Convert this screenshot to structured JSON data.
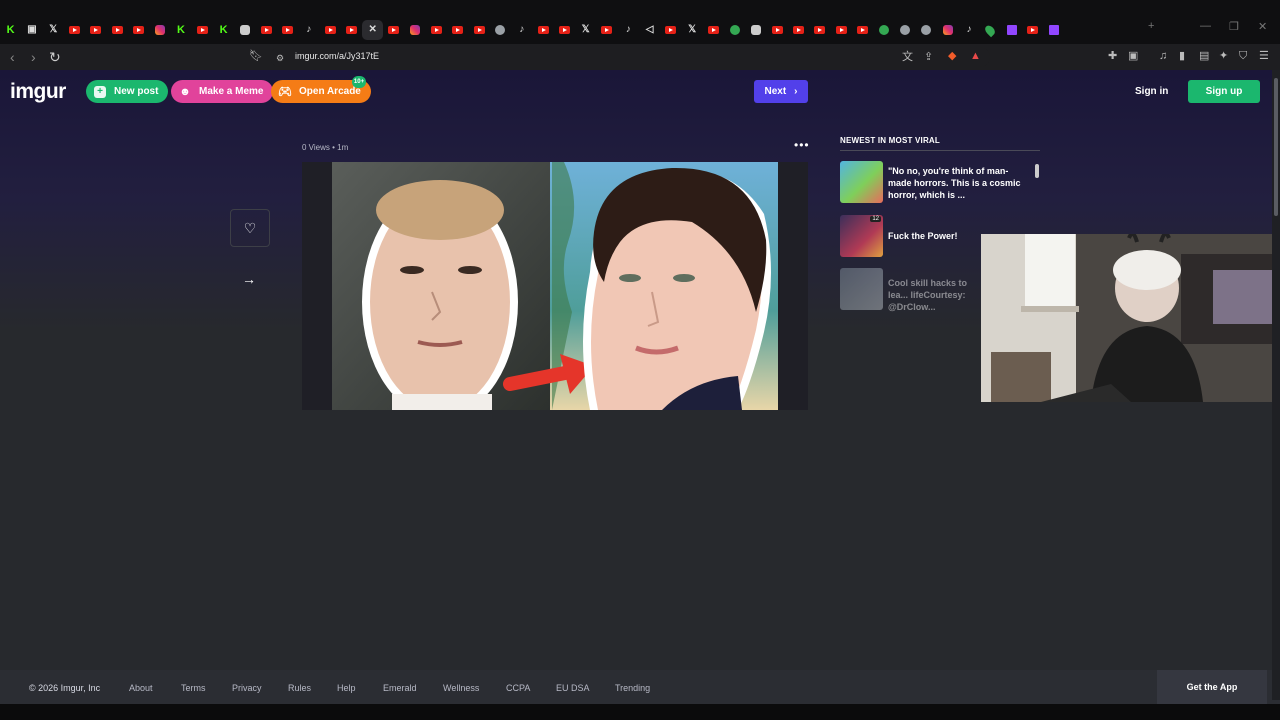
{
  "browser": {
    "tabs": [
      "kick",
      "box",
      "x",
      "yt",
      "yt",
      "yt",
      "yt",
      "ig",
      "kick",
      "yt",
      "kick",
      "ghost",
      "yt",
      "yt",
      "tiktok",
      "yt",
      "yt",
      "close",
      "yt",
      "ig",
      "yt",
      "yt",
      "yt",
      "circ",
      "tiktok",
      "yt",
      "yt",
      "x",
      "yt",
      "tiktok",
      "sound",
      "yt",
      "x",
      "yt",
      "green",
      "ghost",
      "yt",
      "yt",
      "yt",
      "yt",
      "yt",
      "green",
      "circ",
      "circ",
      "ig",
      "tiktok",
      "map",
      "twitch",
      "yt",
      "twitch"
    ],
    "active_tab_index": 17,
    "new_tab_glyph": "+",
    "url": "imgur.com/a/Jy317tE",
    "nav_back": "‹",
    "nav_forward": "›",
    "reload": "↻"
  },
  "header": {
    "logo": "imgur",
    "new_post_label": "New post",
    "make_meme_label": "Make a Meme",
    "open_arcade_label": "Open Arcade",
    "arcade_badge": "10+",
    "next_label": "Next",
    "sign_in_label": "Sign in",
    "sign_up_label": "Sign up"
  },
  "post": {
    "meta": "0 Views • 1m",
    "more_icon": "•••",
    "like_icon": "heart-icon",
    "share_icon": "share-arrow-icon"
  },
  "sidebar": {
    "title": "NEWEST IN MOST VIRAL",
    "items": [
      {
        "title": "\"No no, you're think of man-made horrors. This is a cosmic horror, which is ..."
      },
      {
        "title": "Fuck the Power!",
        "badge": "12"
      },
      {
        "title": "Cool skill hacks to lea... lifeCourtesy: @DrClow..."
      }
    ]
  },
  "footer": {
    "copyright": "© 2026 Imgur, Inc",
    "links": [
      "About",
      "Terms",
      "Privacy",
      "Rules",
      "Help",
      "Emerald",
      "Wellness",
      "CCPA",
      "EU DSA",
      "Trending"
    ],
    "get_app_label": "Get the App"
  },
  "colors": {
    "accent_green": "#1bb76e",
    "accent_pink": "#e1439b",
    "accent_orange": "#f57c16",
    "next_purple": "#5240ea",
    "background": "#27292d"
  }
}
